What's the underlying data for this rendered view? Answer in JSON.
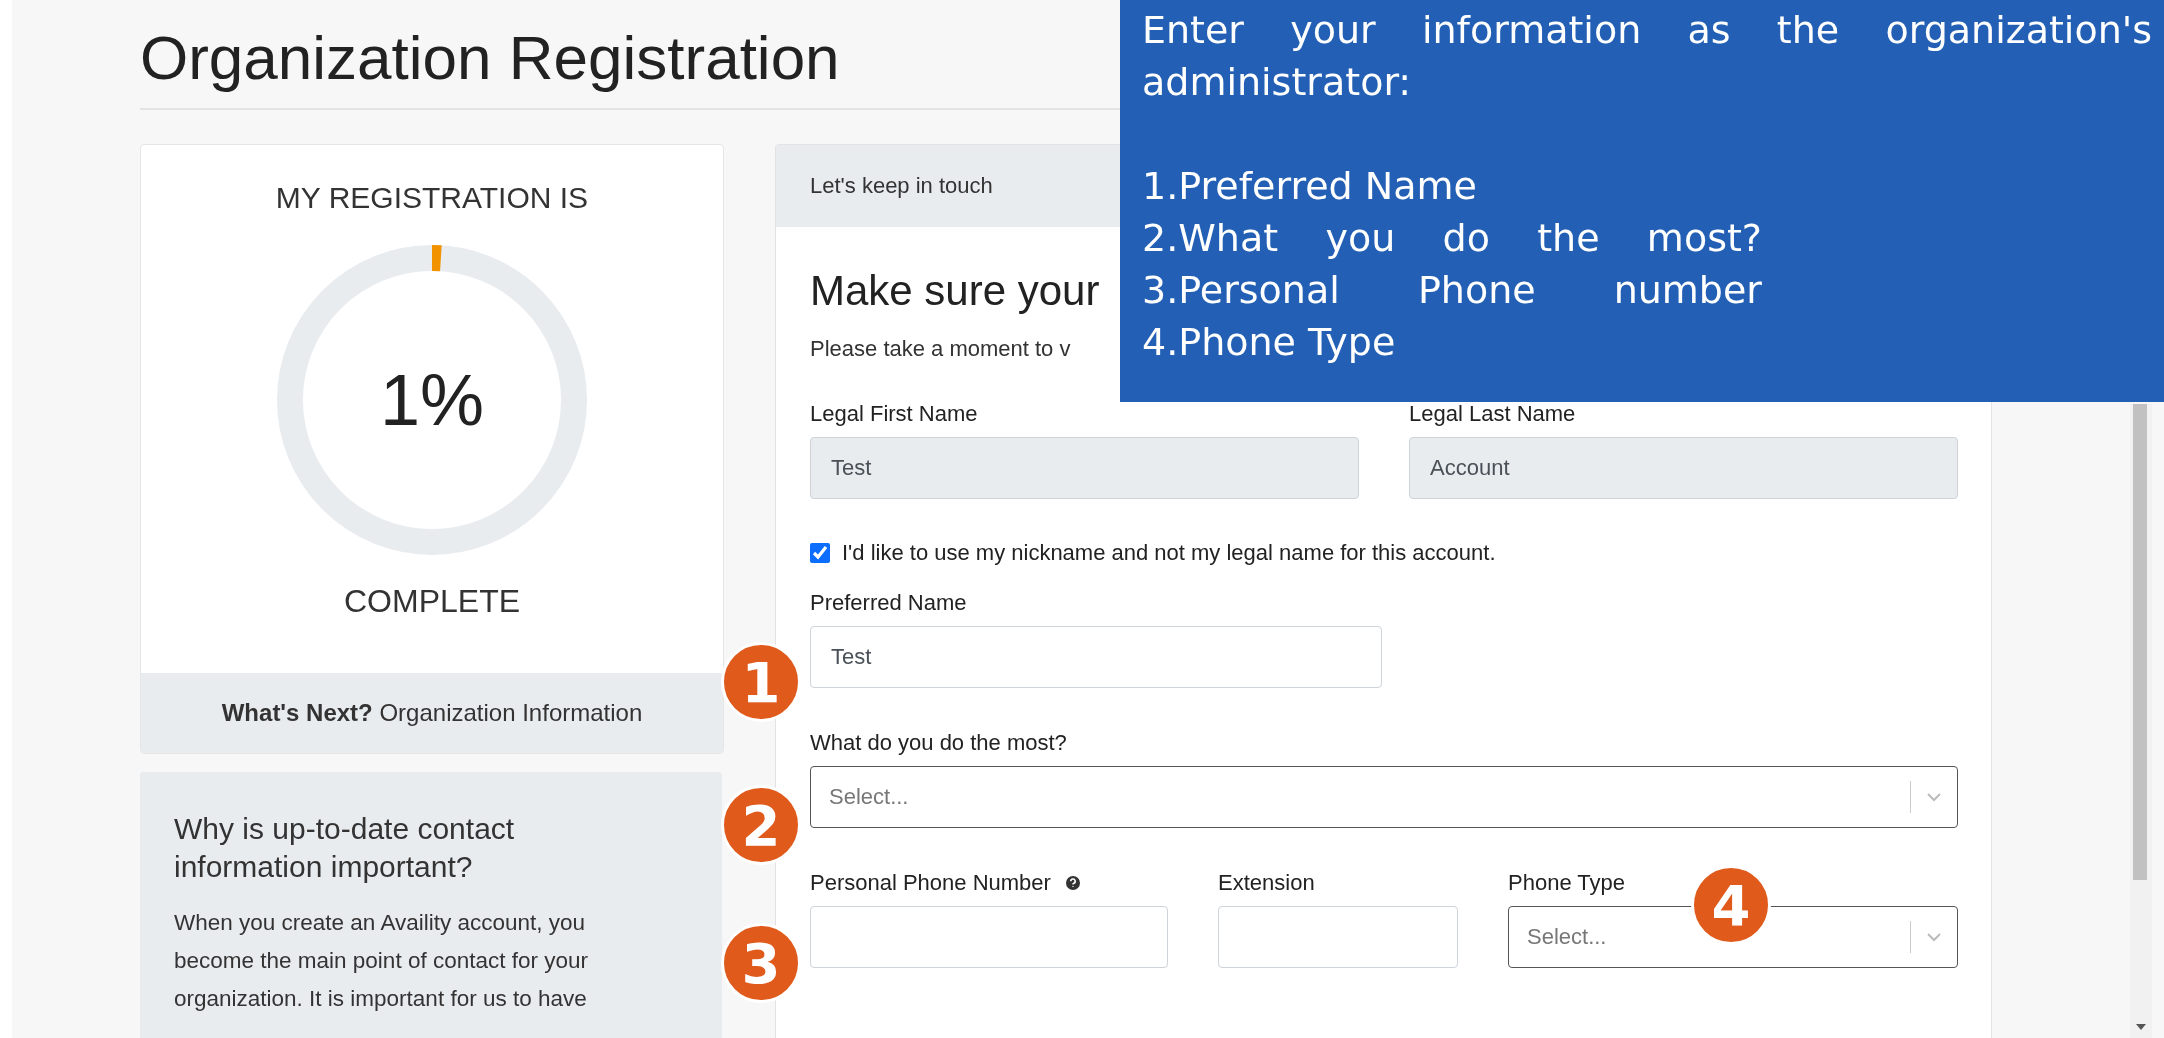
{
  "page_title": "Organization Registration",
  "progress": {
    "heading": "MY REGISTRATION IS",
    "level": 0.01,
    "percent": "1%",
    "caption": "COMPLETE",
    "next": "**What's Next?** Organization Information"
  },
  "info": {
    "heading": "Why is up-to-date contact information important?",
    "body": "When you create an Availity account, you become the main point of contact for your organization. It is important for us to have"
  },
  "form": {
    "header": "Let's keep in touch",
    "heading": "Make sure your",
    "intro": "Please take a moment to v",
    "legal_first": {
      "label": "Legal First Name",
      "value": "Test",
      "disabled": true
    },
    "legal_last": {
      "label": "Legal Last Name",
      "value": "Account",
      "disabled": true
    },
    "nickname": {
      "label": "I'd like to use my nickname and not my legal name for this account.",
      "checked": true
    },
    "preferred": {
      "label": "Preferred Name",
      "value": "Test",
      "disabled": false
    },
    "activity": {
      "label": "What do you do the most?",
      "placeholder": "Select..."
    },
    "phone": {
      "label": "Personal Phone Number",
      "disabled": false
    },
    "extension": {
      "label": "Extension",
      "disabled": false
    },
    "phone_type": {
      "label": "Phone Type",
      "placeholder": "Select..."
    }
  },
  "annotation": {
    "text": "Enter your information as the organization's administrator:",
    "steps": [
      "1.Preferred Name",
      "2.What you do the most?",
      "3.Personal Phone number",
      "4.Phone Type"
    ]
  },
  "markers": [
    {
      "number": "1"
    },
    {
      "number": "2"
    },
    {
      "number": "3"
    },
    {
      "number": "4"
    }
  ]
}
